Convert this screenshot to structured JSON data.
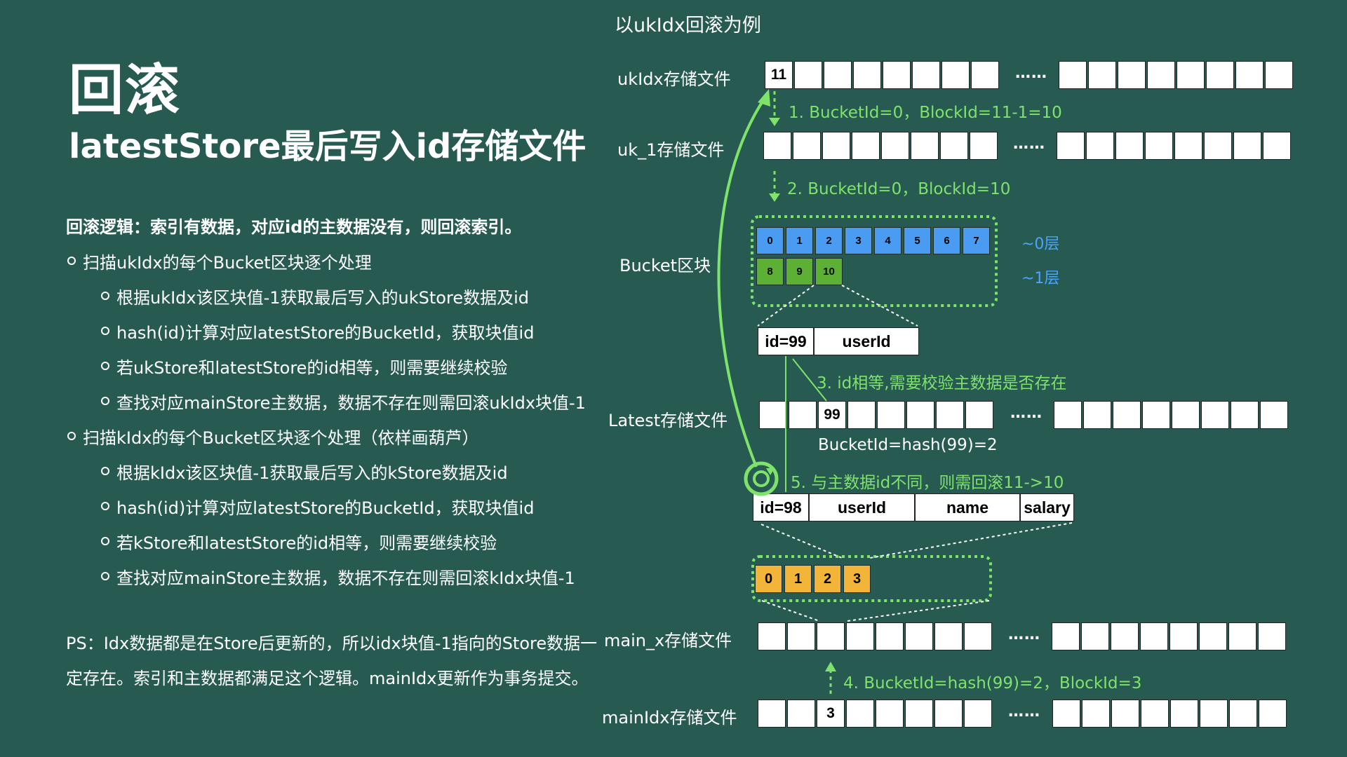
{
  "left": {
    "title": "回滚",
    "subtitle": "latestStore最后写入id存储文件",
    "logic": "回滚逻辑：索引有数据，对应id的主数据没有，则回滚索引。",
    "bullets": [
      {
        "level": 1,
        "text": "扫描ukIdx的每个Bucket区块逐个处理"
      },
      {
        "level": 2,
        "text": "根据ukIdx该区块值-1获取最后写入的ukStore数据及id"
      },
      {
        "level": 2,
        "text": "hash(id)计算对应latestStore的BucketId，获取块值id"
      },
      {
        "level": 2,
        "text": "若ukStore和latestStore的id相等，则需要继续校验"
      },
      {
        "level": 2,
        "text": "查找对应mainStore主数据，数据不存在则需回滚ukIdx块值-1"
      },
      {
        "level": 1,
        "text": "扫描kIdx的每个Bucket区块逐个处理（依样画葫芦）"
      },
      {
        "level": 2,
        "text": "根据kIdx该区块值-1获取最后写入的kStore数据及id"
      },
      {
        "level": 2,
        "text": "hash(id)计算对应latestStore的BucketId，获取块值id"
      },
      {
        "level": 2,
        "text": "若kStore和latestStore的id相等，则需要继续校验"
      },
      {
        "level": 2,
        "text": "查找对应mainStore主数据，数据不存在则需回滚kIdx块值-1"
      }
    ],
    "ps_line1": "PS：Idx数据都是在Store后更新的，所以idx块值-1指向的Store数据一",
    "ps_line2": "定存在。索引和主数据都满足这个逻辑。mainIdx更新作为事务提交。"
  },
  "diagram": {
    "title": "以ukIdx回滚为例",
    "labels": {
      "ukidx": "ukIdx存储文件",
      "uk1": "uk_1存储文件",
      "bucket": "Bucket区块",
      "latest": "Latest存储文件",
      "mainx": "main_x存储文件",
      "mainidx": "mainIdx存储文件"
    },
    "ellipsis": "……",
    "ukidx_first_value": "11",
    "latest_value": "99",
    "mainidx_value": "3",
    "bucket_layer0": [
      "0",
      "1",
      "2",
      "3",
      "4",
      "5",
      "6",
      "7"
    ],
    "bucket_layer1": [
      "8",
      "9",
      "10"
    ],
    "layer0_label": "~0层",
    "layer1_label": "~1层",
    "latest_record": [
      "id=99",
      "userId"
    ],
    "main_record": [
      "id=98",
      "userId",
      "name",
      "salary"
    ],
    "main_blocks": [
      "0",
      "1",
      "2",
      "3"
    ],
    "steps": {
      "s1": "1. BucketId=0，BlockId=11-1=10",
      "s2": "2. BucketId=0，BlockId=10",
      "s3": "3. id相等,需要校验主数据是否存在",
      "hash": "BucketId=hash(99)=2",
      "s4": "4. BucketId=hash(99)=2，BlockId=3",
      "s5": "5. 与主数据id不同，则需回滚11->10"
    },
    "colors": {
      "background": "#275b52",
      "green": "#7fe36b",
      "blue": "#4a9cf2",
      "bucket_green": "#5cb135",
      "orange": "#f2b53a",
      "layer_label": "#4aa3ff"
    }
  }
}
